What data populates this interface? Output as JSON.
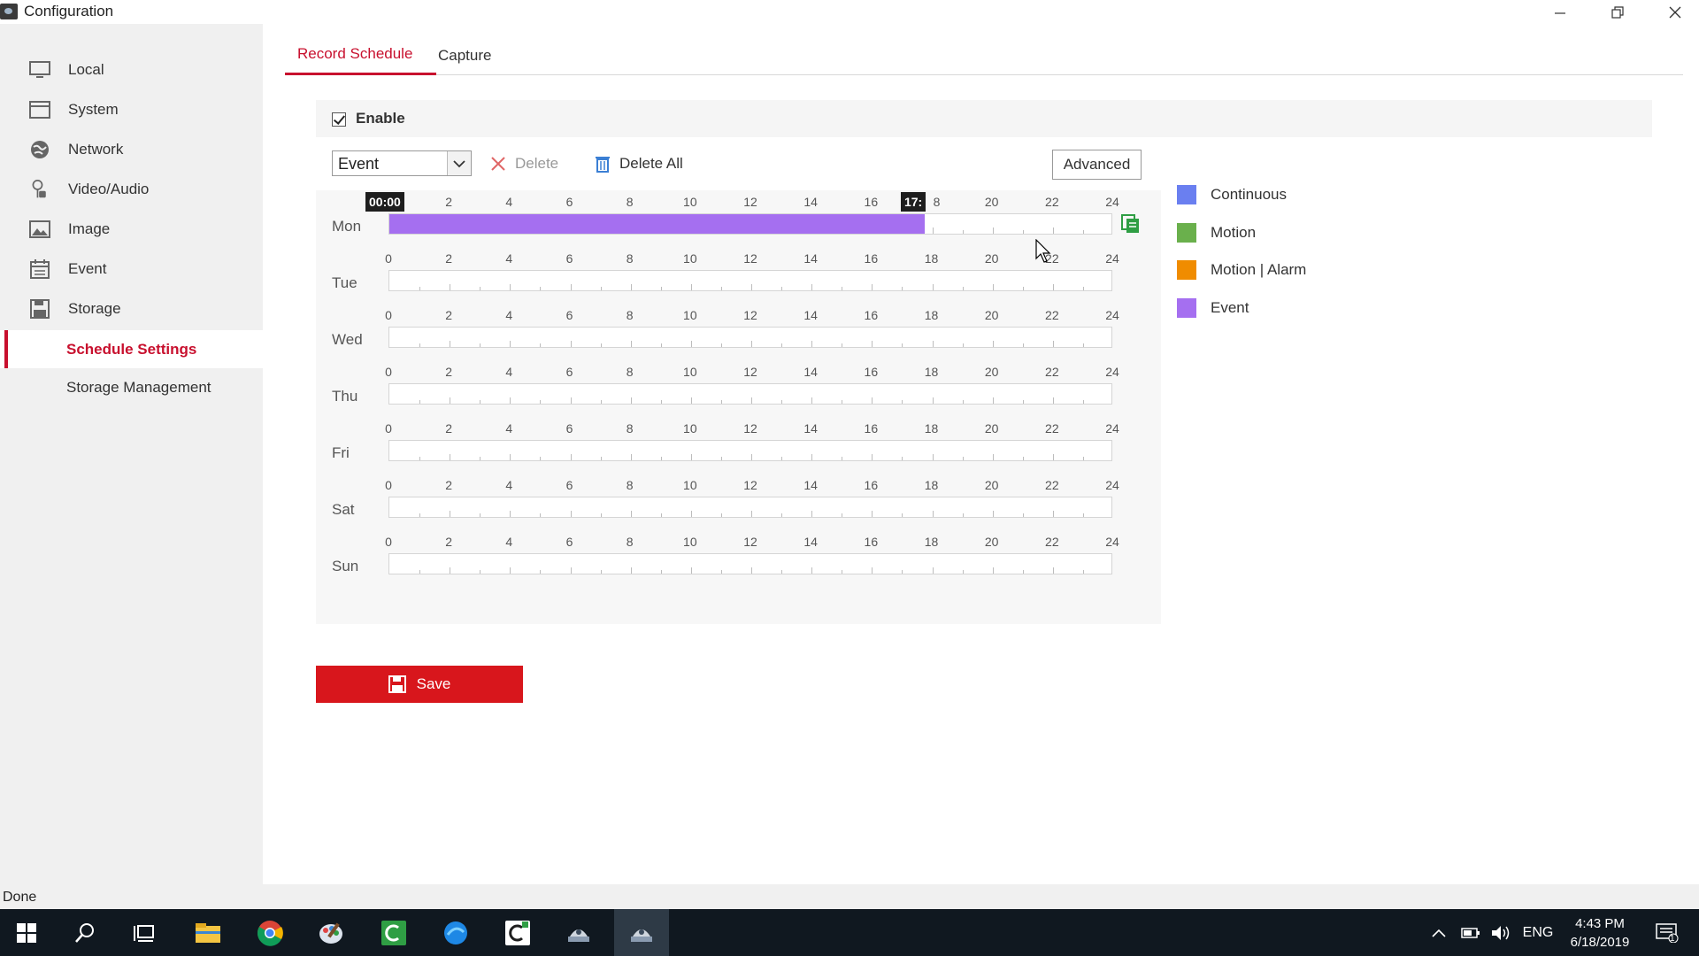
{
  "window": {
    "title": "Configuration"
  },
  "sidebar": {
    "items": [
      {
        "label": "Local",
        "icon": "monitor-icon"
      },
      {
        "label": "System",
        "icon": "system-icon"
      },
      {
        "label": "Network",
        "icon": "globe-icon"
      },
      {
        "label": "Video/Audio",
        "icon": "microphone-camera-icon"
      },
      {
        "label": "Image",
        "icon": "image-icon"
      },
      {
        "label": "Event",
        "icon": "calendar-icon"
      },
      {
        "label": "Storage",
        "icon": "floppy-disk-icon"
      }
    ],
    "subitems": [
      {
        "label": "Schedule Settings",
        "active": true
      },
      {
        "label": "Storage Management",
        "active": false
      }
    ]
  },
  "tabs": [
    {
      "label": "Record Schedule",
      "active": true
    },
    {
      "label": "Capture",
      "active": false
    }
  ],
  "enable": {
    "label": "Enable",
    "checked": true
  },
  "toolbar": {
    "type_select": "Event",
    "delete_label": "Delete",
    "delete_all_label": "Delete All",
    "advanced_label": "Advanced"
  },
  "legend": [
    {
      "label": "Continuous",
      "color": "#6a7ff0"
    },
    {
      "label": "Motion",
      "color": "#6ab04c"
    },
    {
      "label": "Motion | Alarm",
      "color": "#f08c00"
    },
    {
      "label": "Event",
      "color": "#a56ff0"
    }
  ],
  "schedule": {
    "tick_labels_first": [
      "00:00",
      "2",
      "4",
      "6",
      "8",
      "10",
      "12",
      "14",
      "16",
      "17:",
      "8",
      "20",
      "22",
      "24"
    ],
    "tick_labels": [
      "0",
      "2",
      "4",
      "6",
      "8",
      "10",
      "12",
      "14",
      "16",
      "18",
      "20",
      "22",
      "24"
    ],
    "days": [
      {
        "label": "Mon",
        "segments": [
          {
            "start_hour": 0,
            "end_hour": 17.75,
            "type": "Event"
          }
        ]
      },
      {
        "label": "Tue",
        "segments": []
      },
      {
        "label": "Wed",
        "segments": []
      },
      {
        "label": "Thu",
        "segments": []
      },
      {
        "label": "Fri",
        "segments": []
      },
      {
        "label": "Sat",
        "segments": []
      },
      {
        "label": "Sun",
        "segments": []
      }
    ],
    "start_flag": "00:00",
    "end_flag": "17:"
  },
  "save_label": "Save",
  "status": "Done",
  "taskbar": {
    "apps": [
      "start-icon",
      "search-icon",
      "task-view-icon",
      "file-explorer-icon",
      "chrome-icon",
      "paint-icon",
      "camtasia-icon",
      "browser-icon",
      "camtasia-recorder-icon",
      "ivms-icon",
      "ivms-active-icon"
    ],
    "lang": "ENG",
    "time": "4:43 PM",
    "date": "6/18/2019",
    "notification_count": "1"
  }
}
